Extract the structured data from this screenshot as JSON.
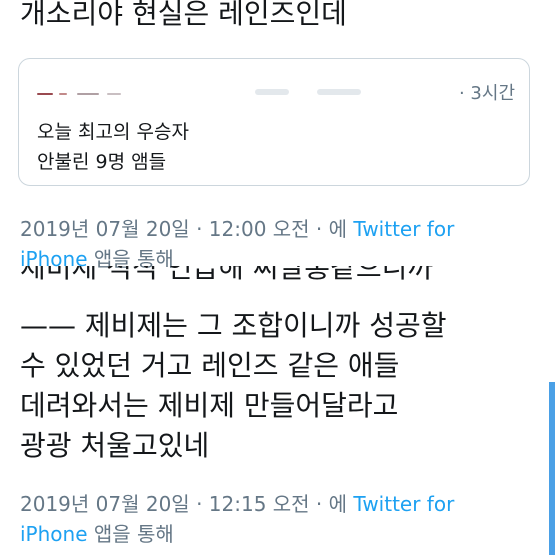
{
  "tweet_top": {
    "text": "개소리야 현실은 레인즈인데"
  },
  "quote": {
    "time": "· 3시간",
    "lines": [
      "오늘 최고의 우승자",
      "안불린 9명 앰들"
    ]
  },
  "meta1": {
    "date": "2019년 07월 20일 · 12:00 오전 · 에 ",
    "link_a": "Twitter for",
    "link_b": "iPhone",
    "suffix": " 앱을 통해"
  },
  "tweet_main": {
    "cut_line": "제비제 적적 언급해 씨발홍같으니까",
    "lines": [
      "—— 제비제는 그 조합이니까 성공할",
      "수 있었던 거고 레인즈 같은 애들",
      "데려와서는 제비제 만들어달라고",
      "광광 처울고있네"
    ]
  },
  "meta2": {
    "date": "2019년 07월 20일 · 12:15 오전 · 에 ",
    "link_a": "Twitter for",
    "link_b": "iPhone",
    "suffix": " 앱을 통해"
  },
  "colors": {
    "accent": "#1da1f2",
    "meta": "#657786",
    "text": "#14171a",
    "scrollbar": "#4aa0e6"
  }
}
